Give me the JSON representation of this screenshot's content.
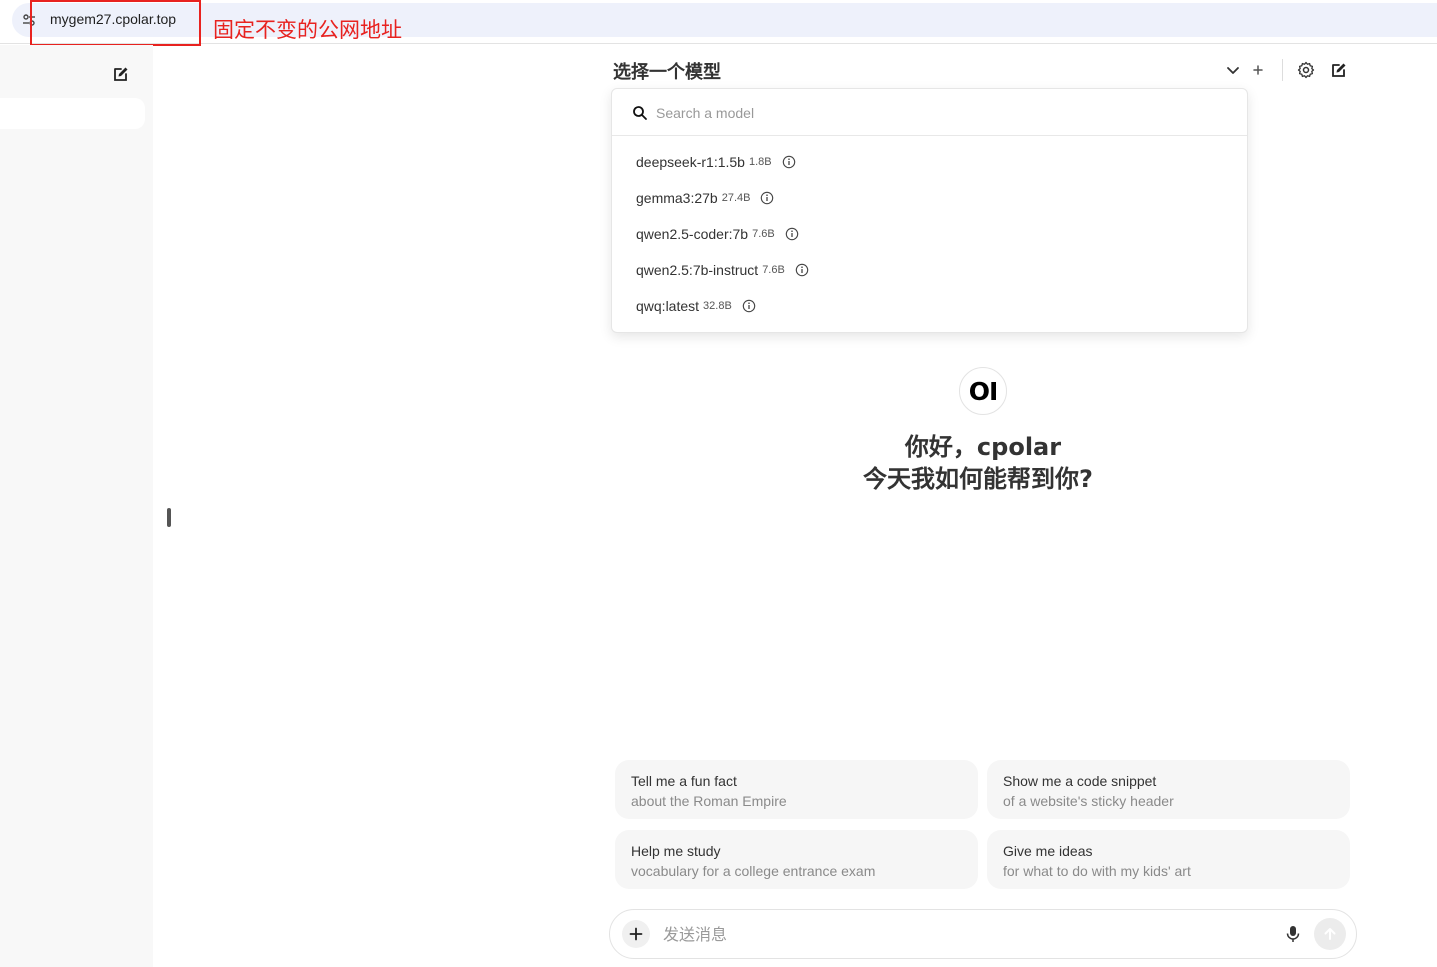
{
  "browser": {
    "url": "mygem27.cpolar.top",
    "annotation": "固定不变的公网地址",
    "highlight_color": "#e8221f"
  },
  "sidebar": {
    "new_chat_icon": "edit-icon"
  },
  "header": {
    "model_selector_label": "选择一个模型",
    "icons": [
      "chevron-down-icon",
      "plus-icon",
      "gear-icon",
      "edit-icon"
    ]
  },
  "model_dropdown": {
    "search_placeholder": "Search a model",
    "models": [
      {
        "name": "deepseek-r1:1.5b",
        "size": "1.8B"
      },
      {
        "name": "gemma3:27b",
        "size": "27.4B"
      },
      {
        "name": "qwen2.5-coder:7b",
        "size": "7.6B"
      },
      {
        "name": "qwen2.5:7b-instruct",
        "size": "7.6B"
      },
      {
        "name": "qwq:latest",
        "size": "32.8B"
      }
    ]
  },
  "greeting": {
    "logo_text": "OI",
    "line1": "你好，cpolar",
    "line2": "今天我如何能帮到你?"
  },
  "suggestions": [
    {
      "title": "Tell me a fun fact",
      "subtitle": "about the Roman Empire"
    },
    {
      "title": "Show me a code snippet",
      "subtitle": "of a website's sticky header"
    },
    {
      "title": "Help me study",
      "subtitle": "vocabulary for a college entrance exam"
    },
    {
      "title": "Give me ideas",
      "subtitle": "for what to do with my kids' art"
    }
  ],
  "chat_input": {
    "placeholder": "发送消息"
  }
}
